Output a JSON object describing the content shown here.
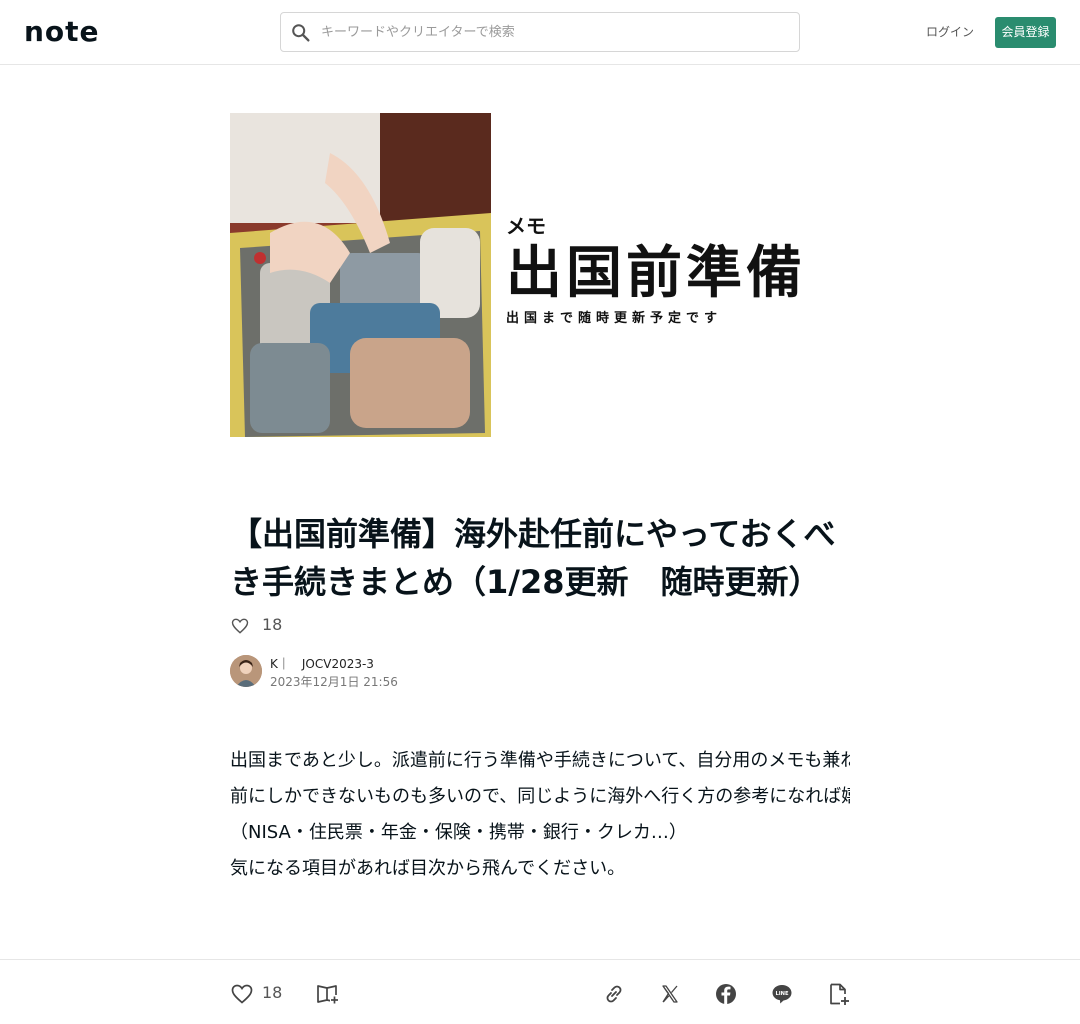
{
  "header": {
    "logo": "note",
    "search_placeholder": "キーワードやクリエイターで検索",
    "login_label": "ログイン",
    "signup_label": "会員登録"
  },
  "hero": {
    "memo": "メモ",
    "title": "出国前準備",
    "subtitle": "出国まで随時更新予定です"
  },
  "article": {
    "title": "【出国前準備】海外赴任前にやっておくべき手続きまとめ（1/28更新　随時更新）",
    "likes": "18",
    "author_name": "K｜　JOCV2023-3",
    "date": "2023年12月1日 21:56",
    "body_lines": [
      "出国まであと少し。派遣前に行う準備や手続きについて、自分用のメモも兼ねてまとめておきます。日本の手続きは出国",
      "前にしかできないものも多いので、同じように海外へ行く方の参考になれば嬉しいです。順次更新",
      "（NISA・住民票・年金・保険・携帯・銀行・クレカ…）",
      "気になる項目があれば目次から飛んでください。"
    ]
  },
  "footer": {
    "likes": "18"
  },
  "colors": {
    "accent": "#2a8c6f",
    "text": "#08131a",
    "border": "#e6e6e6"
  },
  "icons": [
    "search-icon",
    "heart-icon",
    "magazine-add-icon",
    "link-icon",
    "x-icon",
    "facebook-icon",
    "line-icon",
    "embed-icon"
  ]
}
